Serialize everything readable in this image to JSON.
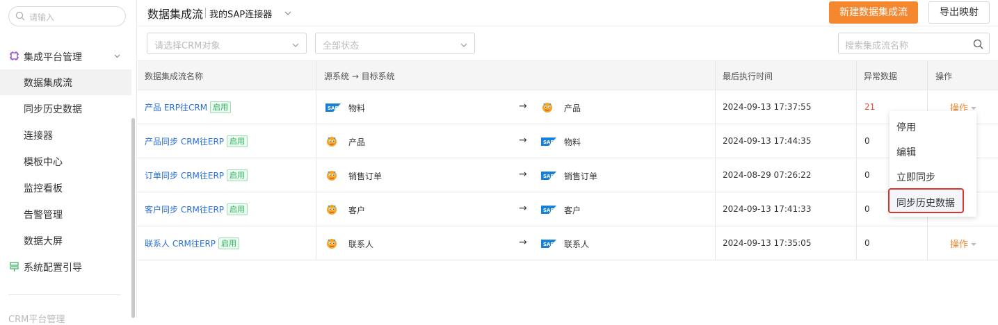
{
  "sidebar": {
    "search_placeholder": "请输入",
    "group_label": "集成平台管理",
    "items": [
      {
        "label": "数据集成流"
      },
      {
        "label": "同步历史数据"
      },
      {
        "label": "连接器"
      },
      {
        "label": "模板中心"
      },
      {
        "label": "监控看板"
      },
      {
        "label": "告警管理"
      },
      {
        "label": "数据大屏"
      }
    ],
    "system_guide": "系统配置引导",
    "crm_label": "CRM平台管理"
  },
  "header": {
    "title": "数据集成流",
    "connector": "我的SAP连接器",
    "new_button": "新建数据集成流",
    "export_button": "导出映射"
  },
  "filters": {
    "crm_object_placeholder": "请选择CRM对象",
    "status_placeholder": "全部状态",
    "search_placeholder": "搜索集成流名称"
  },
  "table": {
    "columns": [
      "数据集成流名称",
      "源系统 → 目标系统",
      "最后执行时间",
      "异常数据",
      "操作"
    ],
    "rows": [
      {
        "name": "产品 ERP往CRM",
        "status": "启用",
        "src_icon": "sap",
        "src": "物料",
        "dst_icon": "crm",
        "dst": "产品",
        "time": "2024-09-13 17:37:55",
        "errors": "21",
        "op": "操作"
      },
      {
        "name": "产品同步 CRM往ERP",
        "status": "启用",
        "src_icon": "crm",
        "src": "产品",
        "dst_icon": "sap",
        "dst": "物料",
        "time": "2024-09-13 17:44:35",
        "errors": "0",
        "op": ""
      },
      {
        "name": "订单同步 CRM往ERP",
        "status": "启用",
        "src_icon": "crm",
        "src": "销售订单",
        "dst_icon": "sap",
        "dst": "销售订单",
        "time": "2024-08-29 07:26:22",
        "errors": "0",
        "op": ""
      },
      {
        "name": "客户同步 CRM往ERP",
        "status": "启用",
        "src_icon": "crm",
        "src": "客户",
        "dst_icon": "sap",
        "dst": "客户",
        "time": "2024-09-13 17:41:33",
        "errors": "0",
        "op": ""
      },
      {
        "name": "联系人 CRM往ERP",
        "status": "启用",
        "src_icon": "crm",
        "src": "联系人",
        "dst_icon": "sap",
        "dst": "联系人",
        "time": "2024-09-13 17:35:05",
        "errors": "0",
        "op": "操作"
      }
    ]
  },
  "dropdown": {
    "items": [
      "停用",
      "编辑",
      "立即同步",
      "同步历史数据"
    ]
  },
  "colors": {
    "accent": "#f5872f",
    "link": "#2a6fd6",
    "error": "#e34d3c",
    "badge": "#2fae5a"
  }
}
